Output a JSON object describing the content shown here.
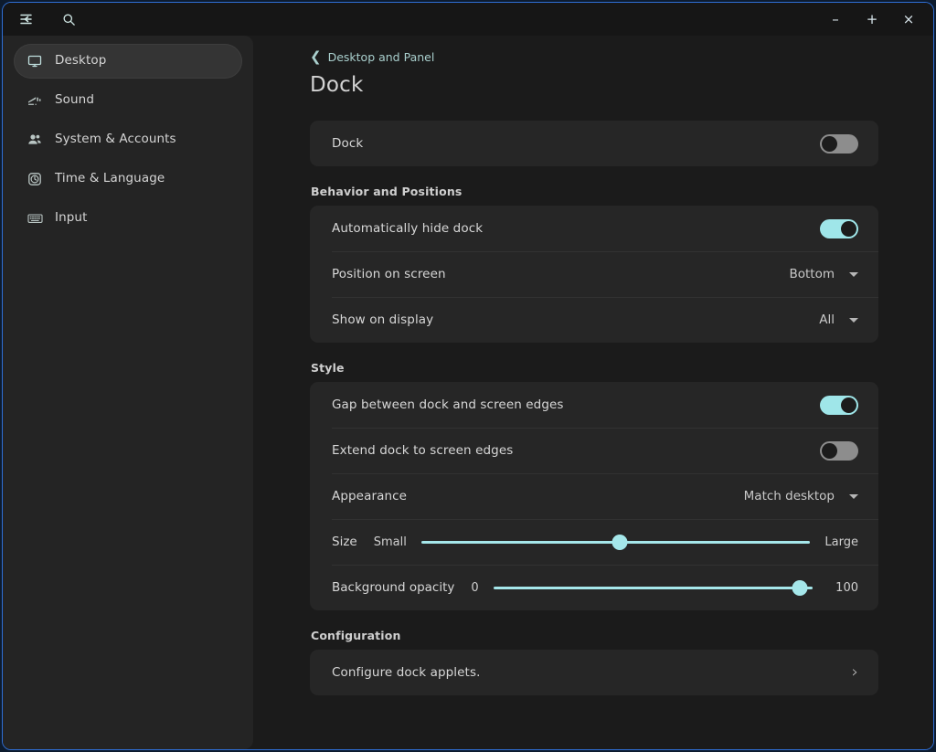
{
  "window": {
    "titlebar": {
      "menu_icon": "hamburger-menu-icon",
      "search_icon": "search-icon",
      "minimize_label": "–",
      "maximize_label": "+",
      "close_label": "×"
    }
  },
  "sidebar": {
    "items": [
      {
        "label": "Desktop",
        "icon": "monitor-icon",
        "active": true
      },
      {
        "label": "Sound",
        "icon": "sound-icon",
        "active": false
      },
      {
        "label": "System & Accounts",
        "icon": "people-icon",
        "active": false
      },
      {
        "label": "Time & Language",
        "icon": "clock-icon",
        "active": false
      },
      {
        "label": "Input",
        "icon": "keyboard-icon",
        "active": false
      }
    ]
  },
  "main": {
    "breadcrumb": {
      "back_glyph": "❮",
      "label": "Desktop and Panel"
    },
    "title": "Dock",
    "dock_card": {
      "label": "Dock",
      "toggle_state": "off"
    },
    "behavior": {
      "heading": "Behavior and Positions",
      "auto_hide": {
        "label": "Automatically hide dock",
        "toggle_state": "on"
      },
      "position": {
        "label": "Position on screen",
        "value": "Bottom"
      },
      "display": {
        "label": "Show on display",
        "value": "All"
      }
    },
    "style": {
      "heading": "Style",
      "gap": {
        "label": "Gap between dock and screen edges",
        "toggle_state": "on"
      },
      "extend": {
        "label": "Extend dock to screen edges",
        "toggle_state": "off"
      },
      "appearance": {
        "label": "Appearance",
        "value": "Match desktop"
      },
      "size": {
        "label": "Size",
        "min_label": "Small",
        "max_label": "Large",
        "percent": 51
      },
      "opacity": {
        "label": "Background opacity",
        "min_label": "0",
        "max_label": "100",
        "percent": 96
      }
    },
    "configuration": {
      "heading": "Configuration",
      "applets": {
        "label": "Configure dock applets.",
        "chevron": "›"
      }
    }
  },
  "colors": {
    "accent": "#9fe6e9",
    "window_border": "#2f6fd6",
    "card_bg": "#262626",
    "sidebar_bg": "#242424",
    "main_bg": "#1b1b1b"
  }
}
